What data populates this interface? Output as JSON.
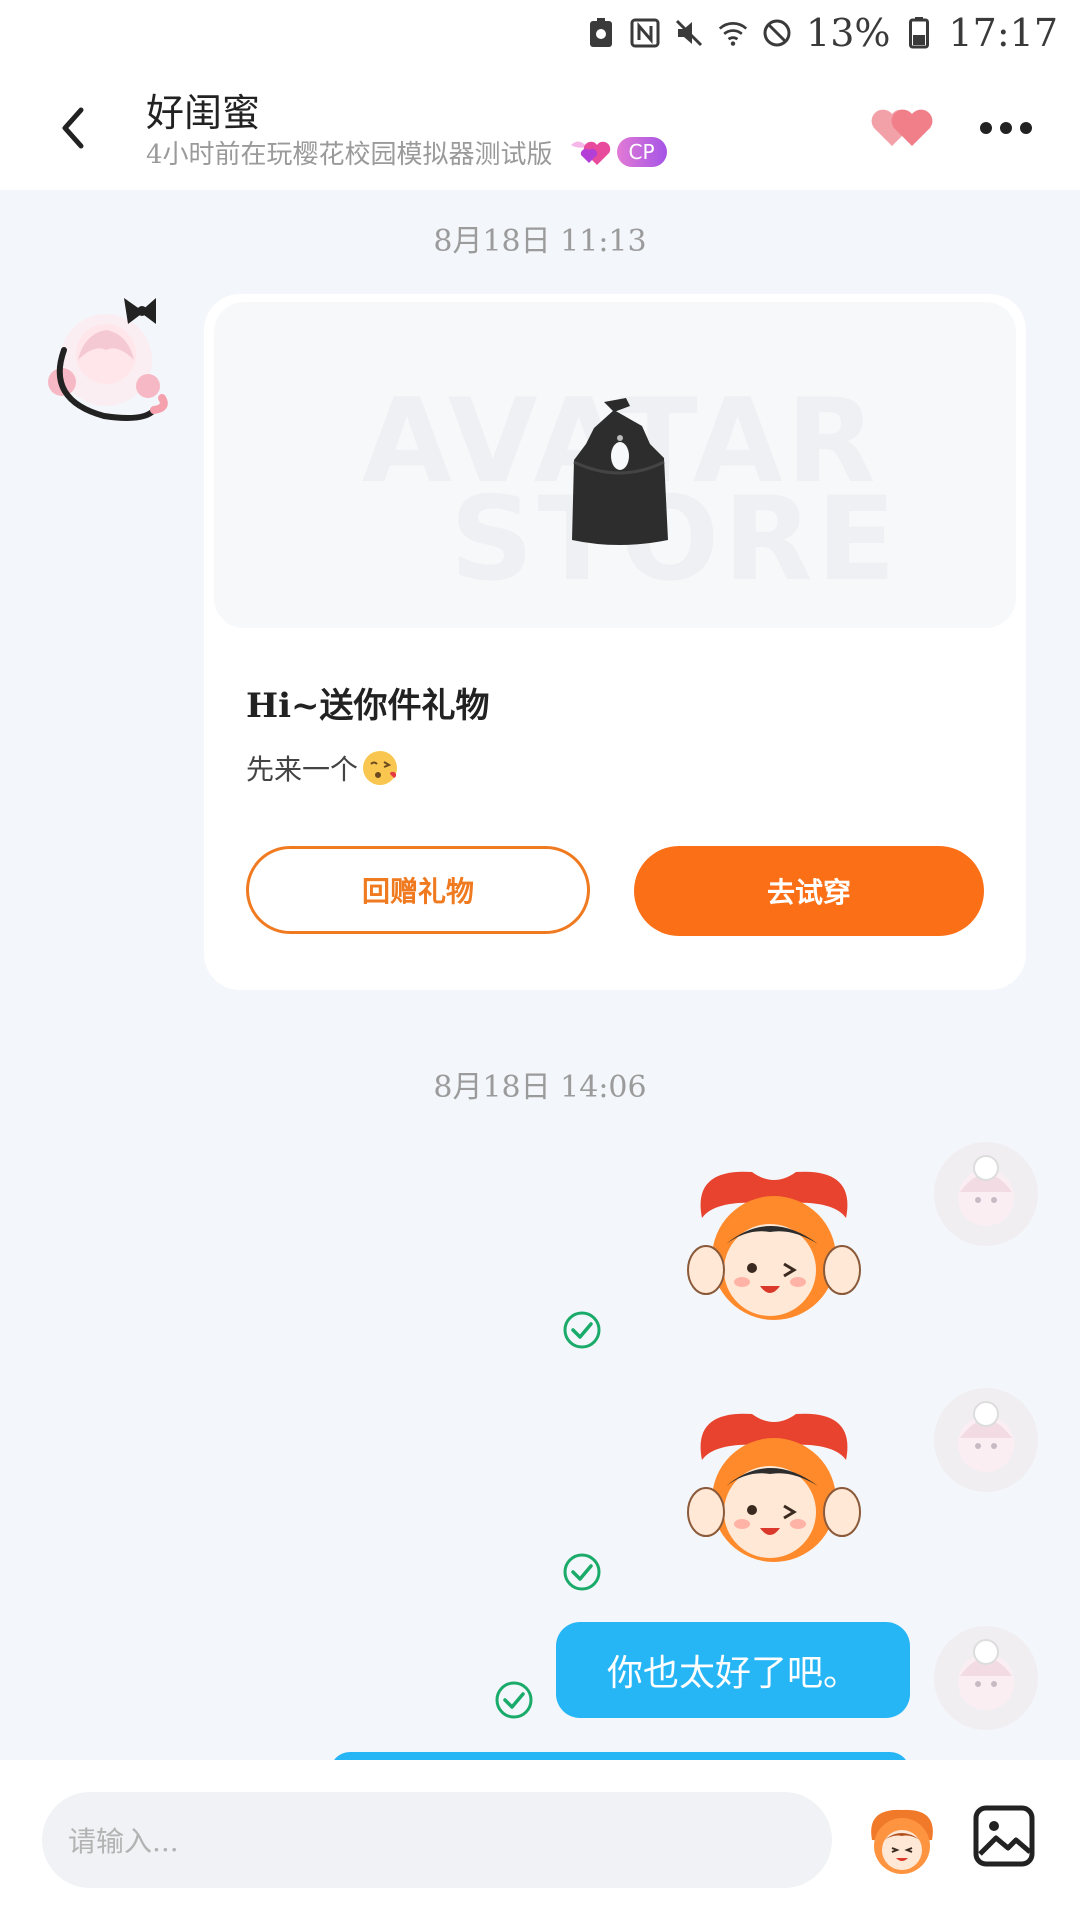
{
  "status_bar": {
    "battery": "13%",
    "time": "17:17"
  },
  "header": {
    "title": "好闺蜜",
    "subtitle": "4小时前在玩樱花校园模拟器测试版",
    "badge": "CP"
  },
  "messages": {
    "timestamp_1": "8月18日 11:13",
    "gift_card": {
      "watermark_line1": "AVATAR",
      "watermark_line2": "STORE",
      "title": "Hi~送你件礼物",
      "message": "先来一个",
      "return_gift_label": "回赠礼物",
      "try_on_label": "去试穿"
    },
    "timestamp_2": "8月18日 14:06",
    "text_message": "你也太好了吧。"
  },
  "input": {
    "placeholder": "请输入..."
  },
  "colors": {
    "accent": "#fb6f17",
    "bubble": "#27b6f5",
    "sent_check": "#1aab6a"
  }
}
